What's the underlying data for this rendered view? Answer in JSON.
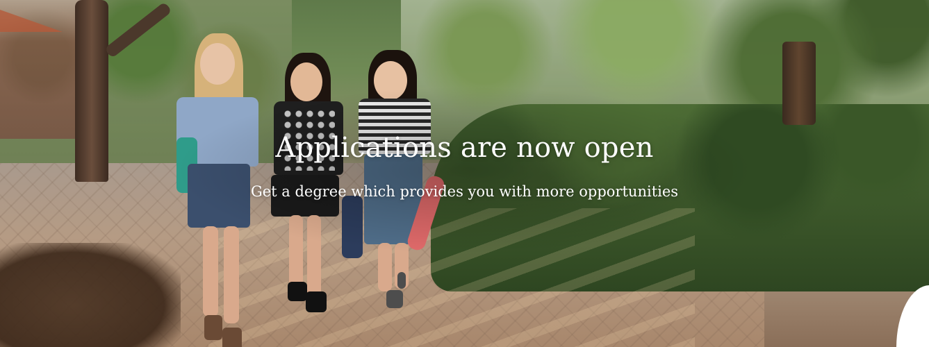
{
  "hero": {
    "title": "Applications are now open",
    "subtitle": "Get a degree which provides you with more opportunities",
    "text_color": "#ffffff"
  }
}
